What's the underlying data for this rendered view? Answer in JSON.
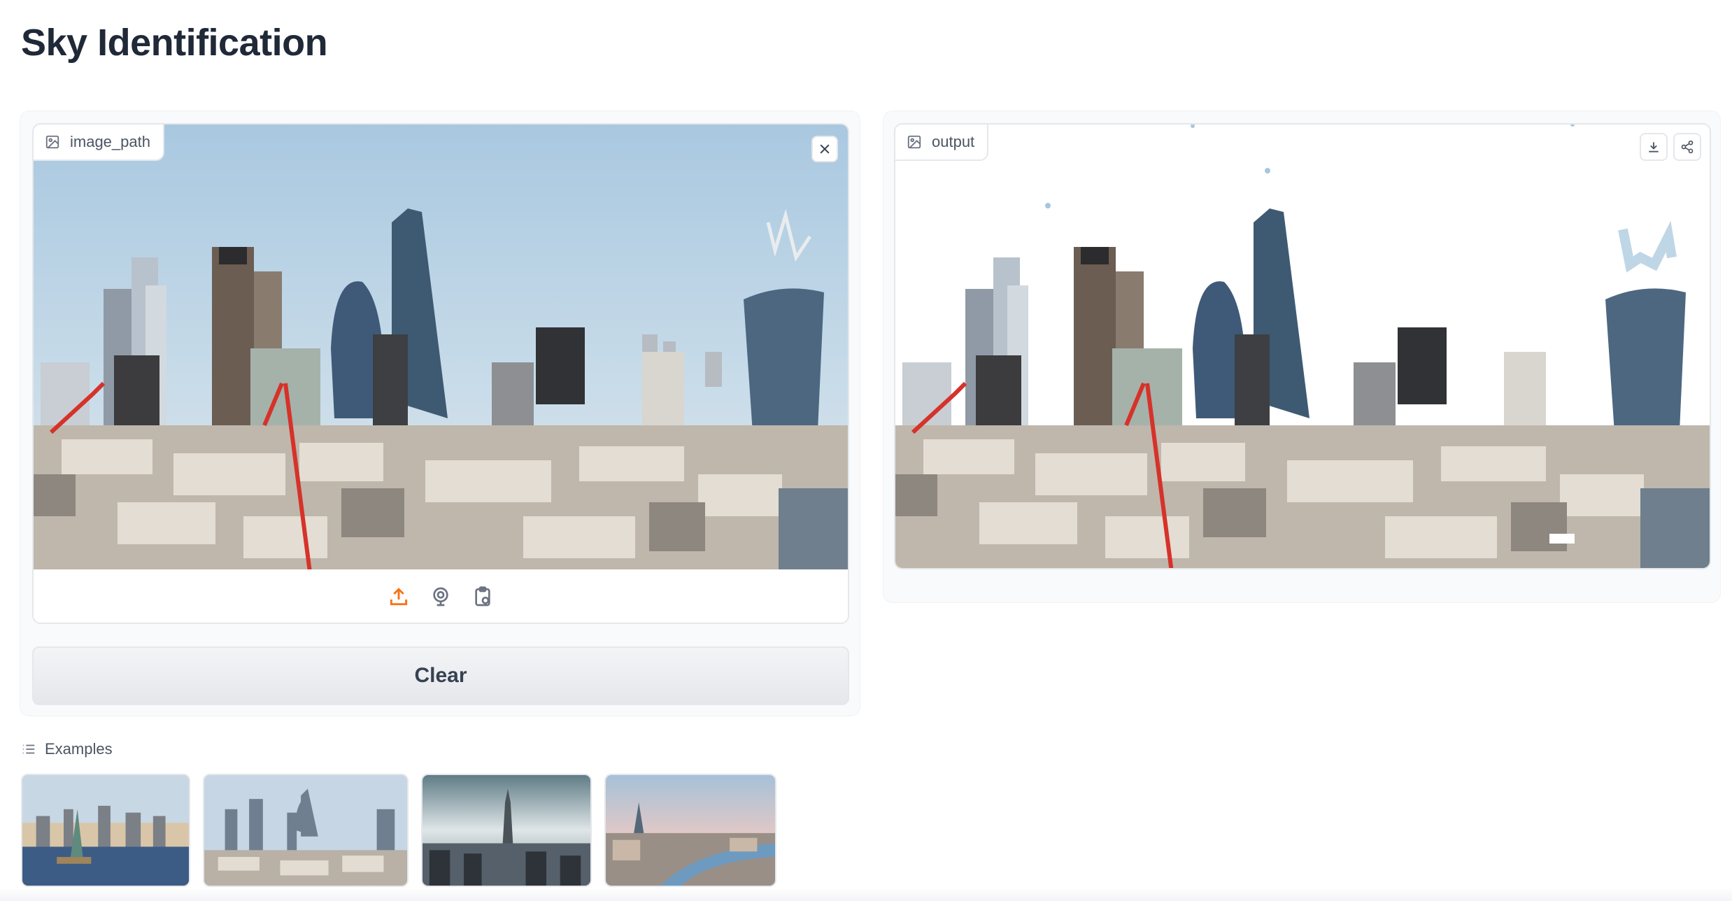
{
  "app": {
    "title": "Sky Identification"
  },
  "input": {
    "label": "image_path",
    "icon": "image-icon"
  },
  "output": {
    "label": "output",
    "icon": "image-icon"
  },
  "buttons": {
    "clear": "Clear"
  },
  "source_toolbar": {
    "items": [
      "upload-icon",
      "webcam-icon",
      "clipboard-icon"
    ],
    "active_color": "#f97316"
  },
  "examples": {
    "label": "Examples",
    "count": 4
  },
  "colors": {
    "title": "#1f2937",
    "panel": "#f9fafb",
    "border": "#e5e7eb",
    "sky": "#b9d3e6"
  }
}
